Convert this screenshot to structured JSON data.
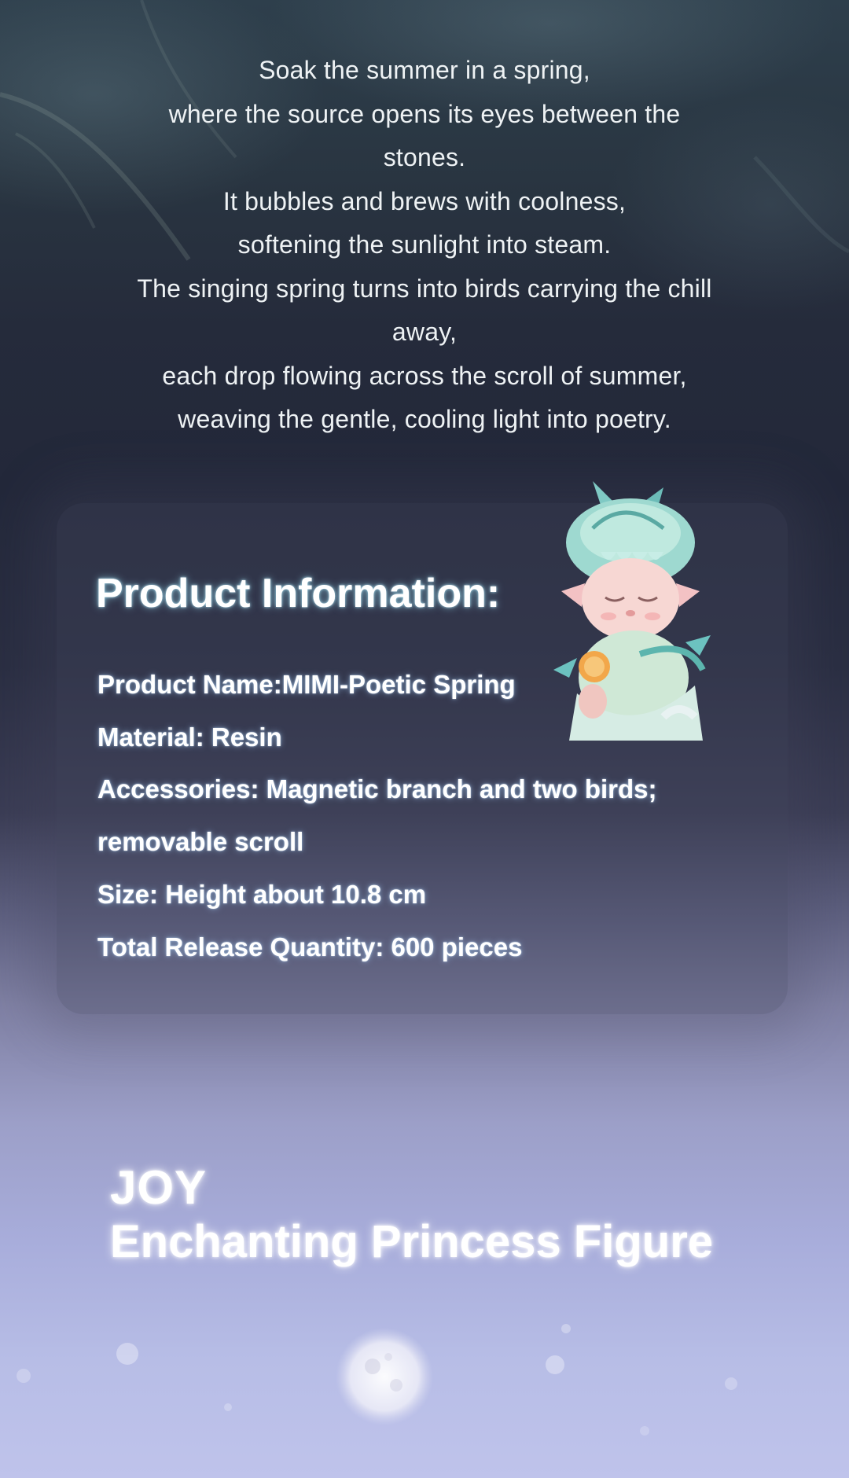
{
  "poem": {
    "lines": [
      "Soak the summer in a spring,",
      "where the source opens its eyes between the stones.",
      "It bubbles and brews with coolness,",
      "softening the sunlight into steam.",
      "The singing spring turns into birds carrying the chill away,",
      "each drop flowing across the scroll of summer,",
      "weaving the gentle, cooling light into poetry."
    ]
  },
  "product_info": {
    "heading": "Product Information:",
    "rows": [
      "Product Name:MIMI-Poetic Spring",
      "Material: Resin",
      "Accessories: Magnetic branch and two birds;",
      "removable scroll",
      "Size: Height about 10.8 cm",
      "Total Release Quantity: 600 pieces"
    ]
  },
  "next_product": {
    "brand": "JOY",
    "name": "Enchanting Princess Figure"
  },
  "colors": {
    "background_top": "#2e3f4c",
    "background_middle": "#23283a",
    "background_bottom": "#bfc3eb",
    "text": "#ffffff",
    "heading_glow": "#8cd2e6"
  }
}
